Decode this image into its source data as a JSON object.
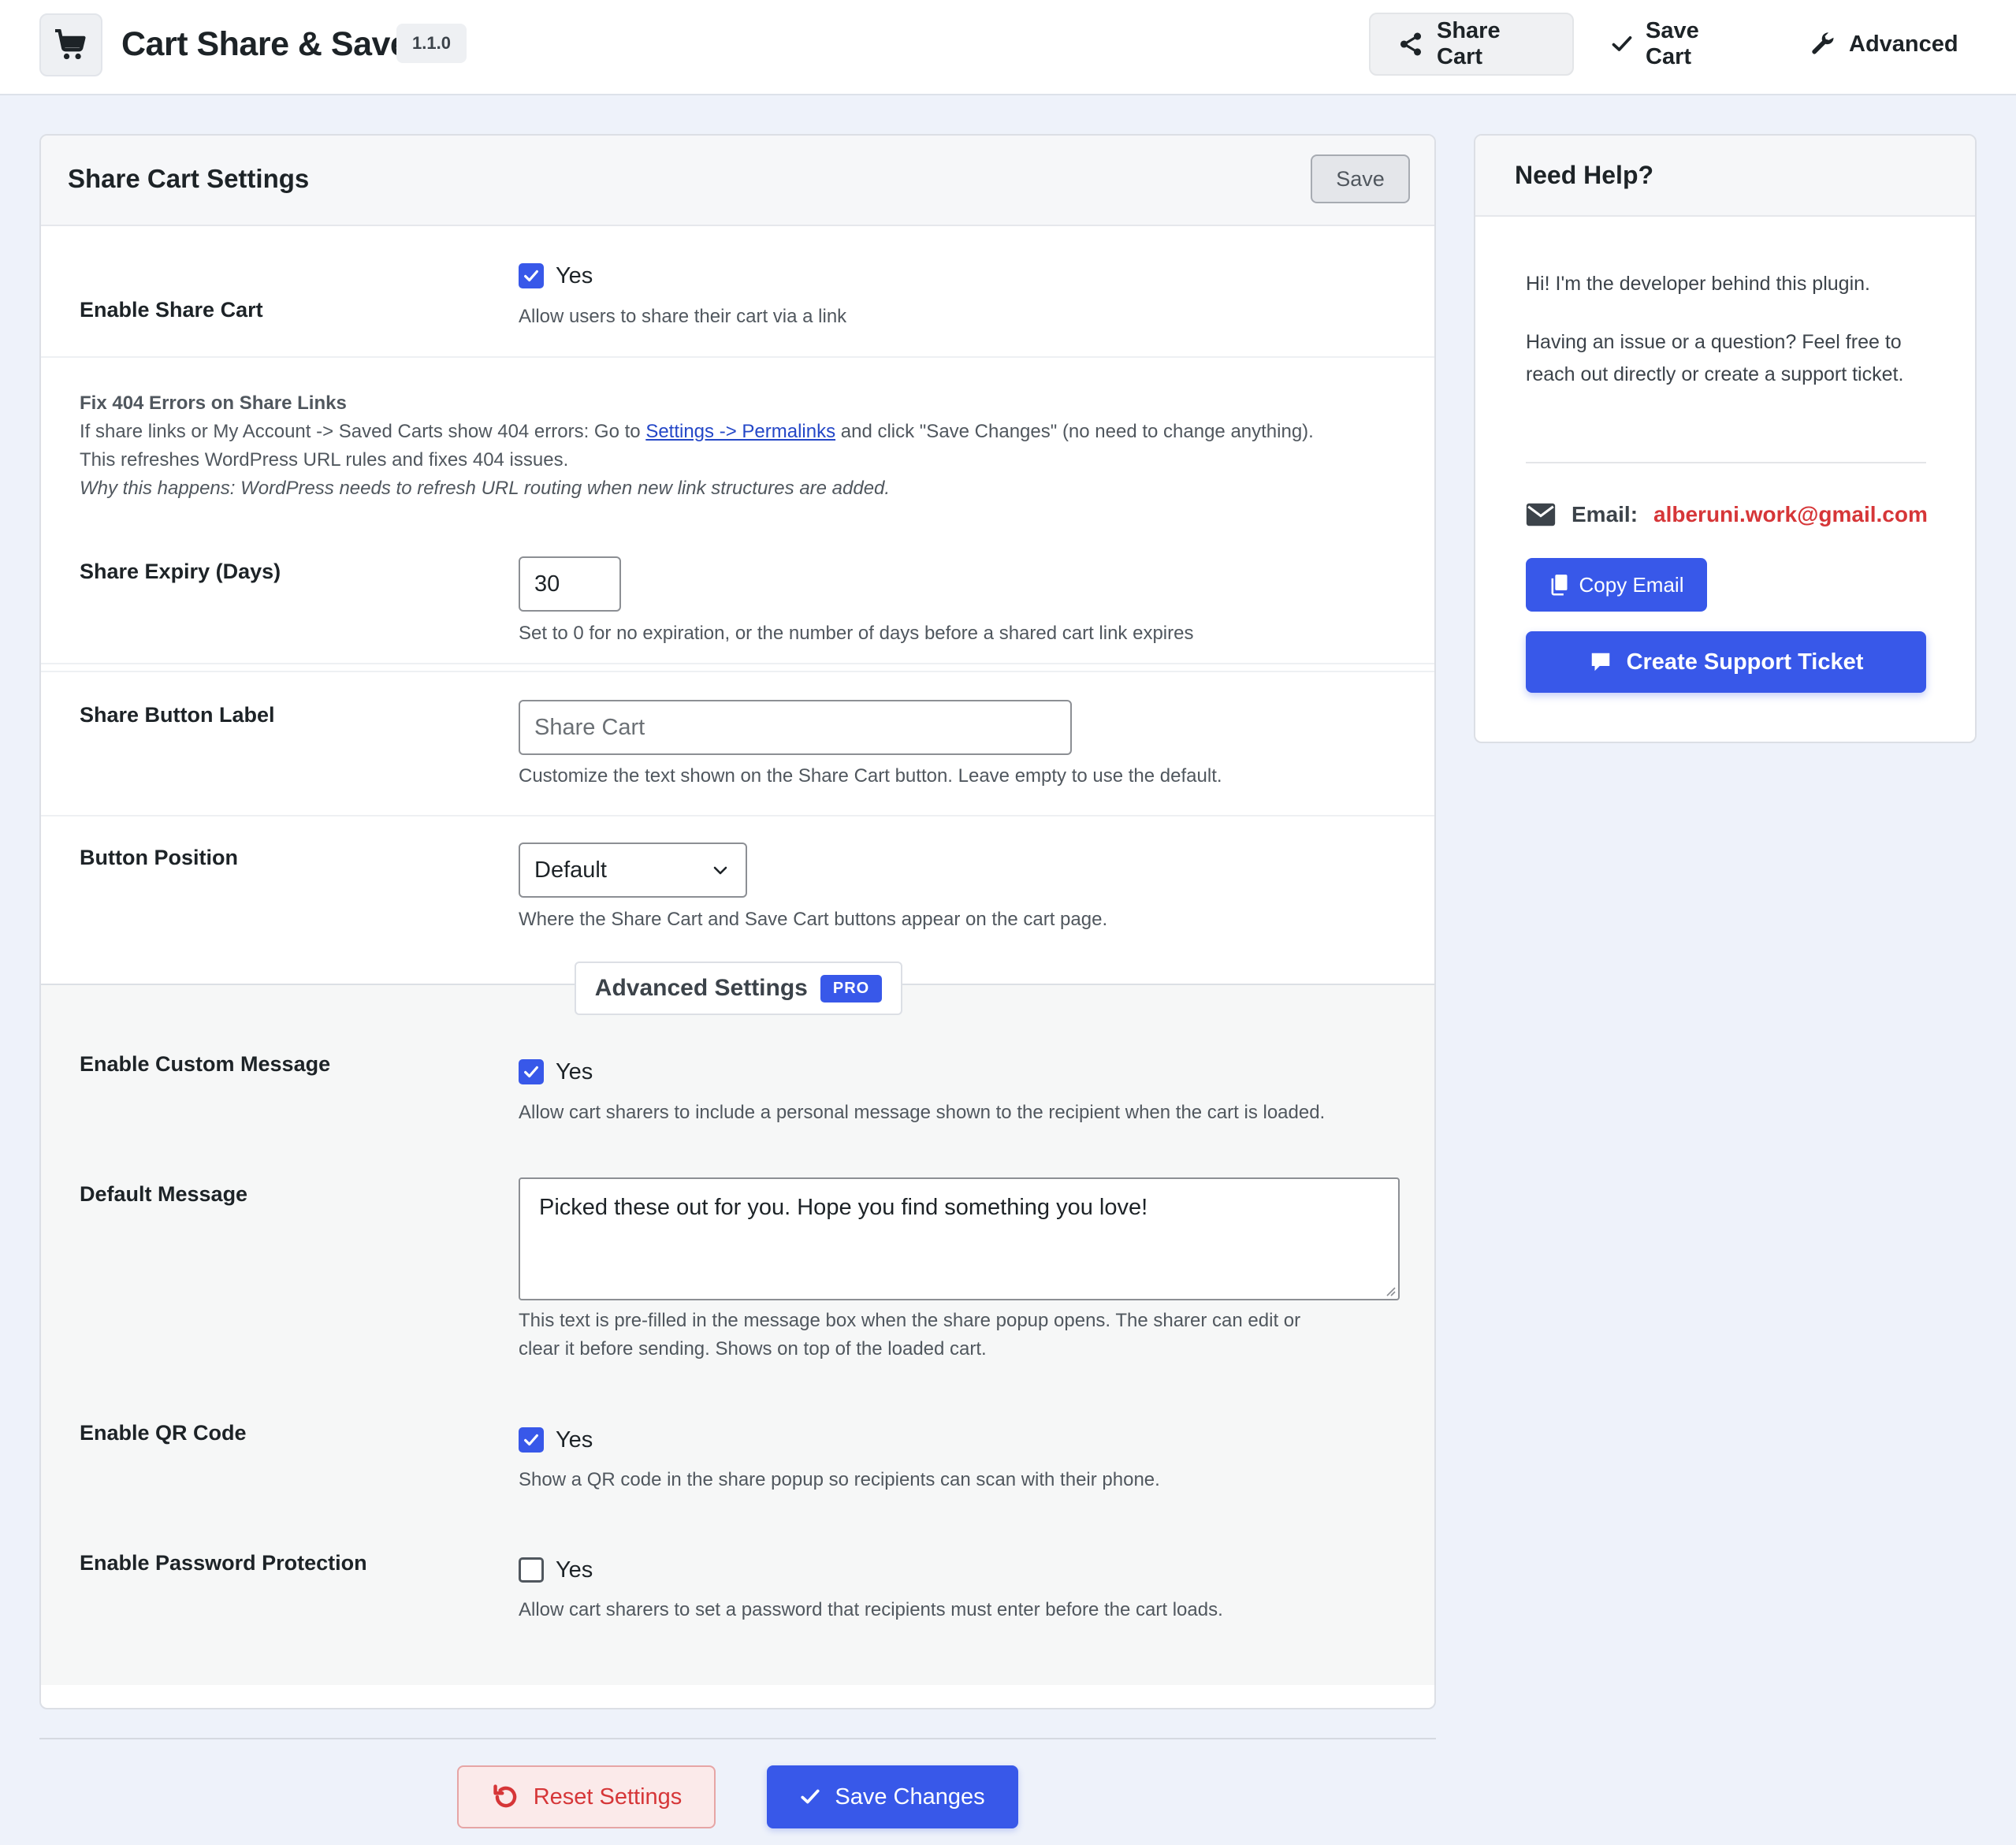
{
  "header": {
    "app_title": "Cart Share & Save",
    "version": "1.1.0",
    "nav": [
      {
        "label": "Share Cart",
        "icon": "share-icon",
        "active": true
      },
      {
        "label": "Save Cart",
        "icon": "check-icon",
        "active": false
      },
      {
        "label": "Advanced",
        "icon": "wrench-icon",
        "active": false
      }
    ]
  },
  "panel": {
    "title": "Share Cart Settings",
    "save_label": "Save",
    "enable_share": {
      "label": "Enable Share Cart",
      "checkbox_label": "Yes",
      "checked": true,
      "help": "Allow users to share their cart via a link"
    },
    "notice": {
      "title": "Fix 404 Errors on Share Links",
      "line1_before": "If share links or My Account -> Saved Carts show 404 errors: Go to ",
      "line1_link": "Settings -> Permalinks",
      "line1_after": " and click \"Save Changes\" (no need to change anything).",
      "line2": "This refreshes WordPress URL rules and fixes 404 issues.",
      "line3": "Why this happens: WordPress needs to refresh URL routing when new link structures are added."
    },
    "expiry": {
      "label": "Share Expiry (Days)",
      "value": "30",
      "help": "Set to 0 for no expiration, or the number of days before a shared cart link expires"
    },
    "button_label": {
      "label": "Share Button Label",
      "placeholder": "Share Cart",
      "help": "Customize the text shown on the Share Cart button. Leave empty to use the default."
    },
    "button_position": {
      "label": "Button Position",
      "selected": "Default",
      "help": "Where the Share Cart and Save Cart buttons appear on the cart page."
    },
    "advanced": {
      "tab_label": "Advanced Settings",
      "badge": "PRO",
      "custom_message": {
        "label": "Enable Custom Message",
        "checkbox_label": "Yes",
        "checked": true,
        "help": "Allow cart sharers to include a personal message shown to the recipient when the cart is loaded."
      },
      "default_message": {
        "label": "Default Message",
        "value": "Picked these out for you. Hope you find something you love!",
        "help_line1": "This text is pre-filled in the message box when the share popup opens. The sharer can edit or",
        "help_line2": "clear it before sending. Shows on top of the loaded cart."
      },
      "qr_code": {
        "label": "Enable QR Code",
        "checkbox_label": "Yes",
        "checked": true,
        "help": "Show a QR code in the share popup so recipients can scan with their phone."
      },
      "password": {
        "label": "Enable Password Protection",
        "checkbox_label": "Yes",
        "checked": false,
        "help": "Allow cart sharers to set a password that recipients must enter before the cart loads."
      }
    }
  },
  "actions": {
    "reset_label": "Reset Settings",
    "save_label": "Save Changes"
  },
  "help_card": {
    "title": "Need Help?",
    "intro": "Hi! I'm the developer behind this plugin.",
    "body": "Having an issue or a question? Feel free to reach out directly or create a support ticket.",
    "email_label": "Email:",
    "email_value": "alberuni.work@gmail.com",
    "copy_label": "Copy Email",
    "ticket_label": "Create Support Ticket"
  },
  "colors": {
    "accent": "#3858e9",
    "danger": "#d63638",
    "background": "#eef2fa"
  }
}
